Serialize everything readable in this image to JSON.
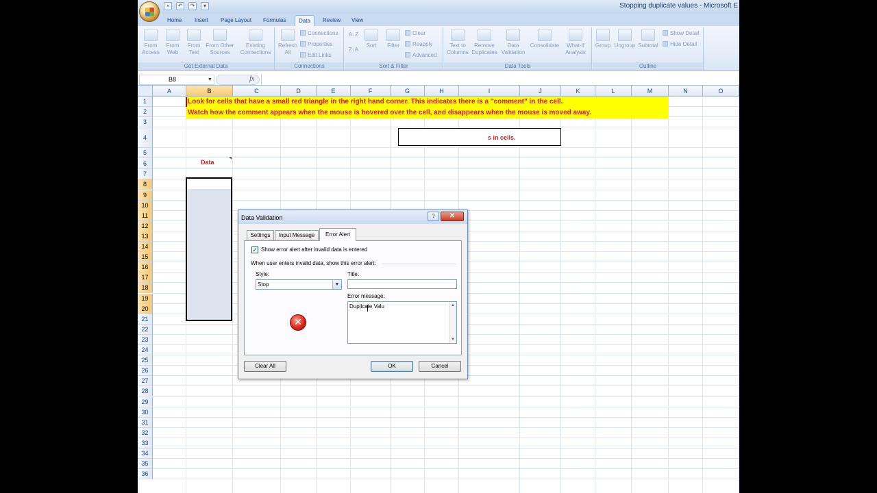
{
  "window": {
    "title": "Stopping duplicate values - Microsoft E"
  },
  "ribbon": {
    "tabs": [
      "Home",
      "Insert",
      "Page Layout",
      "Formulas",
      "Data",
      "Review",
      "View"
    ],
    "active_tab": "Data",
    "groups": {
      "get_external": {
        "label": "Get External Data",
        "buttons": [
          "From Access",
          "From Web",
          "From Text",
          "From Other Sources",
          "Existing Connections"
        ]
      },
      "connections": {
        "label": "Connections",
        "refresh": "Refresh All",
        "small": [
          "Connections",
          "Properties",
          "Edit Links"
        ]
      },
      "sort_filter": {
        "label": "Sort & Filter",
        "sort": "Sort",
        "filter": "Filter",
        "small": [
          "Clear",
          "Reapply",
          "Advanced"
        ]
      },
      "data_tools": {
        "label": "Data Tools",
        "buttons": [
          "Text to Columns",
          "Remove Duplicates",
          "Data Validation",
          "Consolidate",
          "What-If Analysis"
        ]
      },
      "outline": {
        "label": "Outline",
        "buttons": [
          "Group",
          "Ungroup",
          "Subtotal"
        ],
        "small": [
          "Show Detail",
          "Hide Detail"
        ]
      }
    }
  },
  "formula_bar": {
    "name_box": "B8",
    "fx": "fx"
  },
  "sheet": {
    "columns": [
      "A",
      "B",
      "C",
      "D",
      "E",
      "F",
      "G",
      "H",
      "I",
      "J",
      "K",
      "L",
      "M",
      "N",
      "O"
    ],
    "rows": [
      "1",
      "2",
      "3",
      "4",
      "5",
      "6",
      "7",
      "8",
      "9",
      "10",
      "11",
      "12",
      "13",
      "14",
      "15",
      "16",
      "17",
      "18",
      "19",
      "20",
      "21",
      "22",
      "23",
      "24",
      "25",
      "26",
      "27",
      "28",
      "29",
      "30",
      "31",
      "32",
      "33",
      "34",
      "35",
      "36"
    ],
    "selected_column": "B",
    "notice_line1": "Look for cells that have a small red triangle in the right hand corner. This indicates there is a \"comment\" in the cell.",
    "notice_line2": "Watch how the comment appears when the mouse is hovered over the cell, and disappears when the mouse is moved away.",
    "data_header": "Data",
    "instruction_visible": "s in cells."
  },
  "dialog": {
    "title": "Data Validation",
    "tabs": [
      "Settings",
      "Input Message",
      "Error Alert"
    ],
    "active_tab": "Error Alert",
    "show_alert_label": "Show error alert after invalid data is entered",
    "show_alert_checked": true,
    "intro": "When user enters invalid data, show this error alert:",
    "style_label": "Style:",
    "style_value": "Stop",
    "title_label": "Title:",
    "title_value": "",
    "message_label": "Error message:",
    "message_value": "Duplicate Valu",
    "buttons": {
      "clear_all": "Clear All",
      "ok": "OK",
      "cancel": "Cancel"
    }
  },
  "colors": {
    "notice_text": "#e21b1b",
    "notice_bg": "#ffff00",
    "ribbon_tab_text": "#15428b"
  }
}
